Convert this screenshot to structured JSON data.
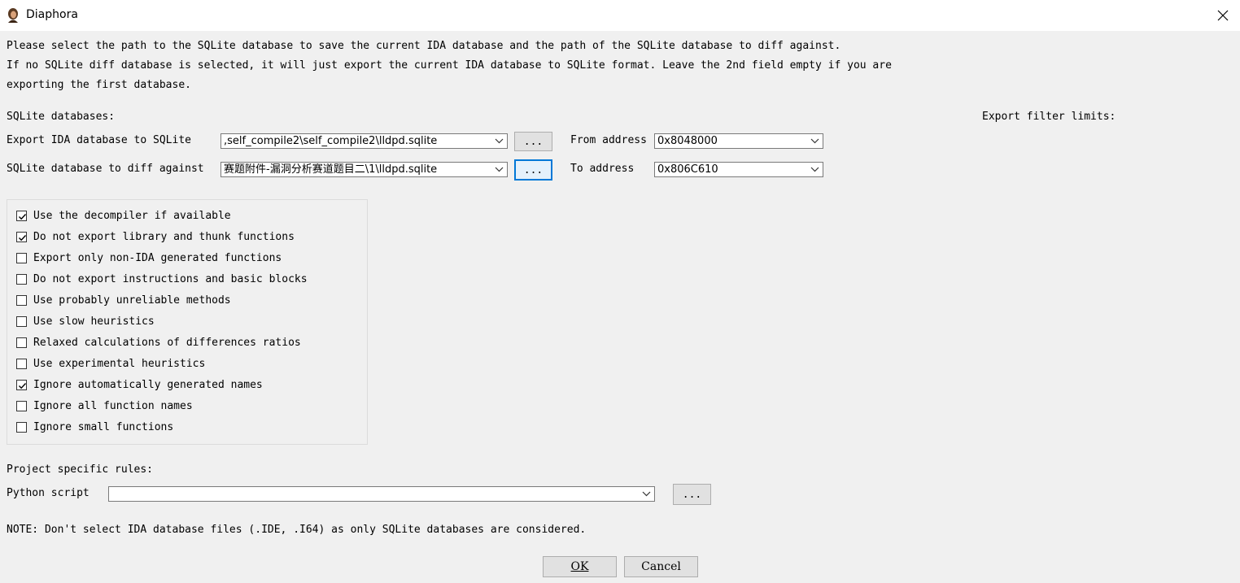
{
  "window": {
    "title": "Diaphora",
    "icon": "diaphora-app-icon",
    "close_icon": "close-icon"
  },
  "intro": {
    "line1": "Please select the path to the SQLite database to save the current IDA database and the path of the SQLite database to diff against.",
    "line2": "If no SQLite diff database is selected, it will just export the current IDA database to SQLite format. Leave the 2nd field empty if you are",
    "line3": "exporting the first database."
  },
  "sqlite": {
    "header": "SQLite databases:",
    "export_label": "Export IDA database to SQLite",
    "export_value": ",self_compile2\\self_compile2\\lldpd.sqlite",
    "diff_label": "SQLite database to diff against",
    "diff_value": "赛题附件-漏洞分析赛道题目二\\1\\lldpd.sqlite",
    "browse_label": "..."
  },
  "filters": {
    "header": "Export filter limits:",
    "from_label": "From address",
    "from_value": "0x8048000",
    "to_label": "To address",
    "to_value": "0x806C610"
  },
  "options": [
    {
      "label": "Use the decompiler if available",
      "checked": true
    },
    {
      "label": "Do not export library and thunk functions",
      "checked": true
    },
    {
      "label": "Export only non-IDA generated functions",
      "checked": false
    },
    {
      "label": "Do not export instructions and basic blocks",
      "checked": false
    },
    {
      "label": "Use probably unreliable methods",
      "checked": false
    },
    {
      "label": "Use slow heuristics",
      "checked": false
    },
    {
      "label": "Relaxed calculations of differences ratios",
      "checked": false
    },
    {
      "label": "Use experimental heuristics",
      "checked": false
    },
    {
      "label": "Ignore automatically generated names",
      "checked": true
    },
    {
      "label": "Ignore all function names",
      "checked": false
    },
    {
      "label": "Ignore small functions",
      "checked": false
    }
  ],
  "project": {
    "header": "Project specific rules:",
    "python_label": "Python script",
    "python_value": "",
    "browse_label": "..."
  },
  "note": "NOTE: Don't select IDA database files (.IDE, .I64) as only SQLite databases are considered.",
  "buttons": {
    "ok": "OK",
    "cancel": "Cancel"
  },
  "colors": {
    "background": "#f0f0f0",
    "focus_accent": "#0078d7"
  }
}
